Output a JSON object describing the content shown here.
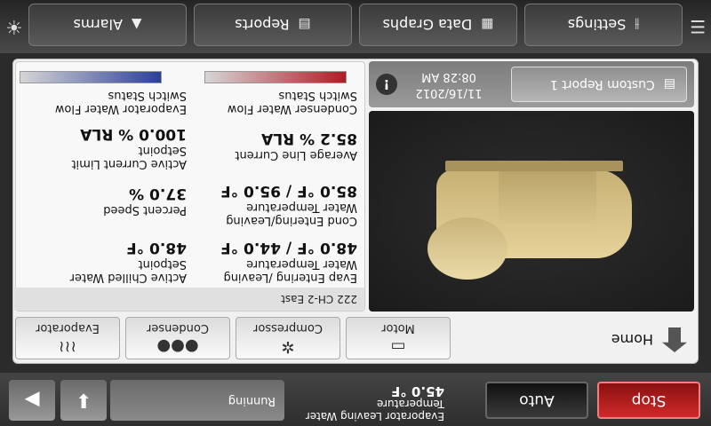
{
  "nav": {
    "alarms": "Alarms",
    "reports": "Reports",
    "data_graphs": "Data Graphs",
    "settings": "Settings"
  },
  "home": {
    "label": "Home"
  },
  "tabs": {
    "evaporator": "Evaporator",
    "condenser": "Condenser",
    "compressor": "Compressor",
    "motor": "Motor"
  },
  "unit_name": "222 CH-2 East",
  "values": {
    "chilled_water_label1": "Active Chilled Water",
    "chilled_water_label2": "Setpoint",
    "chilled_water_val": "48.0 °F",
    "evap_temp_label1": "Evap Entering /Leaving",
    "evap_temp_label2": "Water Temperature",
    "evap_temp_val": "48.0 °F / 44.0 °F",
    "percent_speed_label": "Percent Speed",
    "percent_speed_val": "37.0 %",
    "cond_temp_label1": "Cond Entering/Leaving",
    "cond_temp_label2": "Water Temperature",
    "cond_temp_val": "85.0 °F / 95.0 °F",
    "current_limit_label1": "Active Current Limit",
    "current_limit_label2": "Setpoint",
    "current_limit_val": "100.0 % RLA",
    "avg_current_label": "Average Line Current",
    "avg_current_val": "85.2 % RLA",
    "evap_flow_label1": "Evaporator Water Flow",
    "evap_flow_label2": "Switch Status",
    "cond_flow_label1": "Condenser Water Flow",
    "cond_flow_label2": "Switch Status"
  },
  "info": {
    "custom_report": "Custom Report 1",
    "time": "08:28 AM",
    "date": "11/16/2012"
  },
  "status": {
    "state": "Running",
    "leaving_label1": "Evaporator Leaving Water",
    "leaving_label2": "Temperature",
    "leaving_val": "45.0 °F",
    "auto": "Auto",
    "stop": "Stop"
  },
  "colors": {
    "evap_flow": "#2a3f9a",
    "cond_flow": "#b01c24",
    "stop": "#c01818"
  }
}
